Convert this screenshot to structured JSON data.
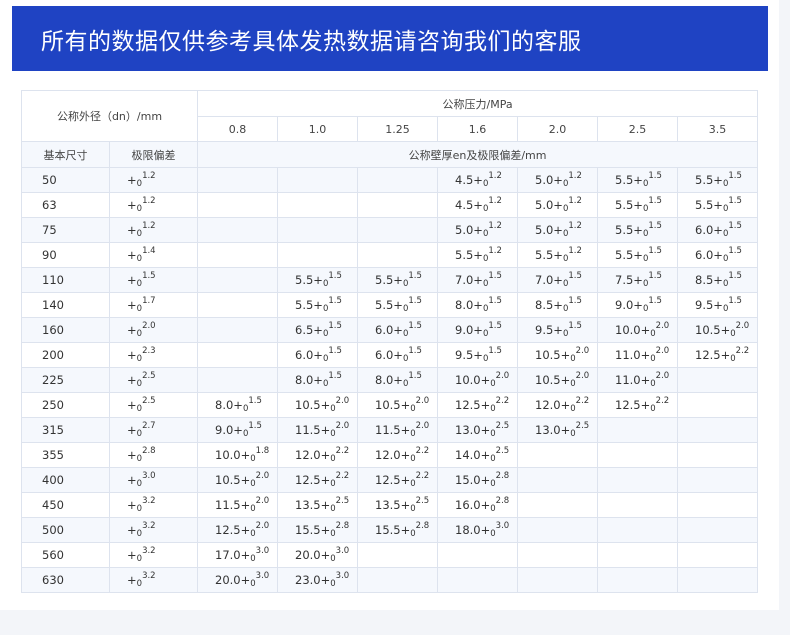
{
  "banner": {
    "text": "所有的数据仅供参考具体发热数据请咨询我们的客服"
  },
  "table": {
    "header": {
      "outer_diameter": "公称外径（dn）/mm",
      "pressure_title": "公称压力/MPa",
      "pressures": [
        "0.8",
        "1.0",
        "1.25",
        "1.6",
        "2.0",
        "2.5",
        "3.5"
      ],
      "basic_size": "基本尺寸",
      "limit_deviation": "极限偏差",
      "wall_title": "公称壁厚en及极限偏差/mm"
    },
    "rows": [
      {
        "size": "50",
        "tol": {
          "base": "+",
          "sub": "0",
          "sup": "1.2"
        },
        "cells": [
          null,
          null,
          null,
          {
            "base": "4.5+",
            "sub": "0",
            "sup": "1.2"
          },
          {
            "base": "5.0+",
            "sub": "0",
            "sup": "1.2"
          },
          {
            "base": "5.5+",
            "sub": "0",
            "sup": "1.5"
          },
          {
            "base": "5.5+",
            "sub": "0",
            "sup": "1.5"
          }
        ]
      },
      {
        "size": "63",
        "tol": {
          "base": "+",
          "sub": "0",
          "sup": "1.2"
        },
        "cells": [
          null,
          null,
          null,
          {
            "base": "4.5+",
            "sub": "0",
            "sup": "1.2"
          },
          {
            "base": "5.0+",
            "sub": "0",
            "sup": "1.2"
          },
          {
            "base": "5.5+",
            "sub": "0",
            "sup": "1.5"
          },
          {
            "base": "5.5+",
            "sub": "0",
            "sup": "1.5"
          }
        ]
      },
      {
        "size": "75",
        "tol": {
          "base": "+",
          "sub": "0",
          "sup": "1.2"
        },
        "cells": [
          null,
          null,
          null,
          {
            "base": "5.0+",
            "sub": "0",
            "sup": "1.2"
          },
          {
            "base": "5.0+",
            "sub": "0",
            "sup": "1.2"
          },
          {
            "base": "5.5+",
            "sub": "0",
            "sup": "1.5"
          },
          {
            "base": "6.0+",
            "sub": "0",
            "sup": "1.5"
          }
        ]
      },
      {
        "size": "90",
        "tol": {
          "base": "+",
          "sub": "0",
          "sup": "1.4"
        },
        "cells": [
          null,
          null,
          null,
          {
            "base": "5.5+",
            "sub": "0",
            "sup": "1.2"
          },
          {
            "base": "5.5+",
            "sub": "0",
            "sup": "1.2"
          },
          {
            "base": "5.5+",
            "sub": "0",
            "sup": "1.5"
          },
          {
            "base": "6.0+",
            "sub": "0",
            "sup": "1.5"
          }
        ]
      },
      {
        "size": "110",
        "tol": {
          "base": "+",
          "sub": "0",
          "sup": "1.5"
        },
        "cells": [
          null,
          {
            "base": "5.5+",
            "sub": "0",
            "sup": "1.5"
          },
          {
            "base": "5.5+",
            "sub": "0",
            "sup": "1.5"
          },
          {
            "base": "7.0+",
            "sub": "0",
            "sup": "1.5"
          },
          {
            "base": "7.0+",
            "sub": "0",
            "sup": "1.5"
          },
          {
            "base": "7.5+",
            "sub": "0",
            "sup": "1.5"
          },
          {
            "base": "8.5+",
            "sub": "0",
            "sup": "1.5"
          }
        ]
      },
      {
        "size": "140",
        "tol": {
          "base": "+",
          "sub": "0",
          "sup": "1.7"
        },
        "cells": [
          null,
          {
            "base": "5.5+",
            "sub": "0",
            "sup": "1.5"
          },
          {
            "base": "5.5+",
            "sub": "0",
            "sup": "1.5"
          },
          {
            "base": "8.0+",
            "sub": "0",
            "sup": "1.5"
          },
          {
            "base": "8.5+",
            "sub": "0",
            "sup": "1.5"
          },
          {
            "base": "9.0+",
            "sub": "0",
            "sup": "1.5"
          },
          {
            "base": "9.5+",
            "sub": "0",
            "sup": "1.5"
          }
        ]
      },
      {
        "size": "160",
        "tol": {
          "base": "+",
          "sub": "0",
          "sup": "2.0"
        },
        "cells": [
          null,
          {
            "base": "6.5+",
            "sub": "0",
            "sup": "1.5"
          },
          {
            "base": "6.0+",
            "sub": "0",
            "sup": "1.5"
          },
          {
            "base": "9.0+",
            "sub": "0",
            "sup": "1.5"
          },
          {
            "base": "9.5+",
            "sub": "0",
            "sup": "1.5"
          },
          {
            "base": "10.0+",
            "sub": "0",
            "sup": "2.0"
          },
          {
            "base": "10.5+",
            "sub": "0",
            "sup": "2.0"
          }
        ]
      },
      {
        "size": "200",
        "tol": {
          "base": "+",
          "sub": "0",
          "sup": "2.3"
        },
        "cells": [
          null,
          {
            "base": "6.0+",
            "sub": "0",
            "sup": "1.5"
          },
          {
            "base": "6.0+",
            "sub": "0",
            "sup": "1.5"
          },
          {
            "base": "9.5+",
            "sub": "0",
            "sup": "1.5"
          },
          {
            "base": "10.5+",
            "sub": "0",
            "sup": "2.0"
          },
          {
            "base": "11.0+",
            "sub": "0",
            "sup": "2.0"
          },
          {
            "base": "12.5+",
            "sub": "0",
            "sup": "2.2"
          }
        ]
      },
      {
        "size": "225",
        "tol": {
          "base": "+",
          "sub": "0",
          "sup": "2.5"
        },
        "cells": [
          null,
          {
            "base": "8.0+",
            "sub": "0",
            "sup": "1.5"
          },
          {
            "base": "8.0+",
            "sub": "0",
            "sup": "1.5"
          },
          {
            "base": "10.0+",
            "sub": "0",
            "sup": "2.0"
          },
          {
            "base": "10.5+",
            "sub": "0",
            "sup": "2.0"
          },
          {
            "base": "11.0+",
            "sub": "0",
            "sup": "2.0"
          },
          null
        ]
      },
      {
        "size": "250",
        "tol": {
          "base": "+",
          "sub": "0",
          "sup": "2.5"
        },
        "cells": [
          {
            "base": "8.0+",
            "sub": "0",
            "sup": "1.5"
          },
          {
            "base": "10.5+",
            "sub": "0",
            "sup": "2.0"
          },
          {
            "base": "10.5+",
            "sub": "0",
            "sup": "2.0"
          },
          {
            "base": "12.5+",
            "sub": "0",
            "sup": "2.2"
          },
          {
            "base": "12.0+",
            "sub": "0",
            "sup": "2.2"
          },
          {
            "base": "12.5+",
            "sub": "0",
            "sup": "2.2"
          },
          null
        ]
      },
      {
        "size": "315",
        "tol": {
          "base": "+",
          "sub": "0",
          "sup": "2.7"
        },
        "cells": [
          {
            "base": "9.0+",
            "sub": "0",
            "sup": "1.5"
          },
          {
            "base": "11.5+",
            "sub": "0",
            "sup": "2.0"
          },
          {
            "base": "11.5+",
            "sub": "0",
            "sup": "2.0"
          },
          {
            "base": "13.0+",
            "sub": "0",
            "sup": "2.5"
          },
          {
            "base": "13.0+",
            "sub": "0",
            "sup": "2.5"
          },
          null,
          null
        ]
      },
      {
        "size": "355",
        "tol": {
          "base": "+",
          "sub": "0",
          "sup": "2.8"
        },
        "cells": [
          {
            "base": "10.0+",
            "sub": "0",
            "sup": "1.8"
          },
          {
            "base": "12.0+",
            "sub": "0",
            "sup": "2.2"
          },
          {
            "base": "12.0+",
            "sub": "0",
            "sup": "2.2"
          },
          {
            "base": "14.0+",
            "sub": "0",
            "sup": "2.5"
          },
          null,
          null,
          null
        ]
      },
      {
        "size": "400",
        "tol": {
          "base": "+",
          "sub": "0",
          "sup": "3.0"
        },
        "cells": [
          {
            "base": "10.5+",
            "sub": "0",
            "sup": "2.0"
          },
          {
            "base": "12.5+",
            "sub": "0",
            "sup": "2.2"
          },
          {
            "base": "12.5+",
            "sub": "0",
            "sup": "2.2"
          },
          {
            "base": "15.0+",
            "sub": "0",
            "sup": "2.8"
          },
          null,
          null,
          null
        ]
      },
      {
        "size": "450",
        "tol": {
          "base": "+",
          "sub": "0",
          "sup": "3.2"
        },
        "cells": [
          {
            "base": "11.5+",
            "sub": "0",
            "sup": "2.0"
          },
          {
            "base": "13.5+",
            "sub": "0",
            "sup": "2.5"
          },
          {
            "base": "13.5+",
            "sub": "0",
            "sup": "2.5"
          },
          {
            "base": "16.0+",
            "sub": "0",
            "sup": "2.8"
          },
          null,
          null,
          null
        ]
      },
      {
        "size": "500",
        "tol": {
          "base": "+",
          "sub": "0",
          "sup": "3.2"
        },
        "cells": [
          {
            "base": "12.5+",
            "sub": "0",
            "sup": "2.0"
          },
          {
            "base": "15.5+",
            "sub": "0",
            "sup": "2.8"
          },
          {
            "base": "15.5+",
            "sub": "0",
            "sup": "2.8"
          },
          {
            "base": "18.0+",
            "sub": "0",
            "sup": "3.0"
          },
          null,
          null,
          null
        ]
      },
      {
        "size": "560",
        "tol": {
          "base": "+",
          "sub": "0",
          "sup": "3.2"
        },
        "cells": [
          {
            "base": "17.0+",
            "sub": "0",
            "sup": "3.0"
          },
          {
            "base": "20.0+",
            "sub": "0",
            "sup": "3.0"
          },
          null,
          null,
          null,
          null,
          null
        ]
      },
      {
        "size": "630",
        "tol": {
          "base": "+",
          "sub": "0",
          "sup": "3.2"
        },
        "cells": [
          {
            "base": "20.0+",
            "sub": "0",
            "sup": "3.0"
          },
          {
            "base": "23.0+",
            "sub": "0",
            "sup": "3.0"
          },
          null,
          null,
          null,
          null,
          null
        ]
      }
    ]
  },
  "colors": {
    "banner_bg": "#1f43c3",
    "banner_text": "#ffffff",
    "grid_line": "#dde3ee",
    "stripe": "#f5f8fd",
    "page_bg": "#f3f5f9"
  }
}
